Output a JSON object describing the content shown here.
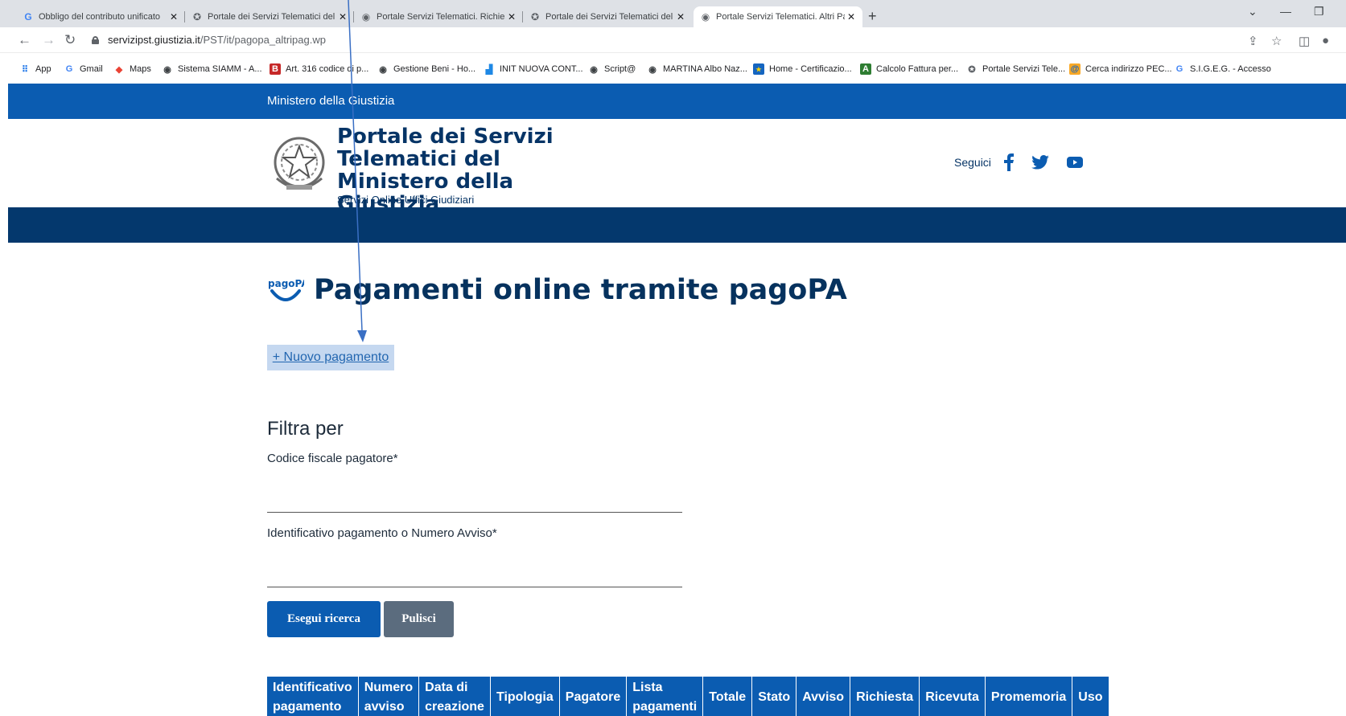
{
  "browser": {
    "tabs": [
      {
        "title": "Obbligo del contributo unificato",
        "icon": "google-icon",
        "active": false
      },
      {
        "title": "Portale dei Servizi Telematici del",
        "icon": "emblem-icon",
        "active": false
      },
      {
        "title": "Portale Servizi Telematici. Richies",
        "icon": "globe-icon",
        "active": false
      },
      {
        "title": "Portale dei Servizi Telematici del",
        "icon": "emblem-icon",
        "active": false
      },
      {
        "title": "Portale Servizi Telematici. Altri Pa",
        "icon": "globe-icon",
        "active": true
      }
    ],
    "url": {
      "domain": "servizipst.giustizia.it",
      "path": "/PST/it/pagopa_altripag.wp"
    },
    "bookmarks": [
      {
        "label": "App",
        "icon": "apps-grid-icon"
      },
      {
        "label": "Gmail",
        "icon": "google-icon"
      },
      {
        "label": "Maps",
        "icon": "maps-pin-icon"
      },
      {
        "label": "Sistema SIAMM - A...",
        "icon": "globe-icon"
      },
      {
        "label": "Art. 316 codice di p...",
        "icon": "brocardi-icon"
      },
      {
        "label": "Gestione Beni - Ho...",
        "icon": "globe-icon"
      },
      {
        "label": "INIT NUOVA CONT...",
        "icon": "chart-icon"
      },
      {
        "label": "Script@",
        "icon": "globe-icon"
      },
      {
        "label": "MARTINA Albo Naz...",
        "icon": "globe-icon"
      },
      {
        "label": "Home - Certificazio...",
        "icon": "eu-icon"
      },
      {
        "label": "Calcolo Fattura per...",
        "icon": "calc-icon"
      },
      {
        "label": "Portale Servizi Tele...",
        "icon": "emblem-icon"
      },
      {
        "label": "Cerca indirizzo PEC...",
        "icon": "pec-icon"
      },
      {
        "label": "S.I.G.E.G. - Accesso",
        "icon": "google-icon"
      }
    ]
  },
  "site": {
    "ministry": "Ministero della Giustizia",
    "title": "Portale dei Servizi Telematici del Ministero della Giustizia",
    "subtitle": "Servizi Online Uffici Giudiziari",
    "follow": "Seguici",
    "social": [
      "facebook-icon",
      "twitter-icon",
      "youtube-icon"
    ]
  },
  "page": {
    "logo_text": "pagoPA",
    "title": "Pagamenti online tramite pagoPA",
    "new_payment": "+ Nuovo pagamento",
    "filter_title": "Filtra per",
    "fields": [
      {
        "label": "Codice fiscale pagatore*",
        "value": ""
      },
      {
        "label": "Identificativo pagamento o Numero Avviso*",
        "value": ""
      }
    ],
    "search_button": "Esegui ricerca",
    "clear_button": "Pulisci",
    "table_headers": [
      [
        "Identificativo",
        "pagamento"
      ],
      [
        "Numero",
        "avviso"
      ],
      [
        "Data di",
        "creazione"
      ],
      [
        "Tipologia"
      ],
      [
        "Pagatore"
      ],
      [
        "Lista",
        "pagamenti"
      ],
      [
        "Totale"
      ],
      [
        "Stato"
      ],
      [
        "Avviso"
      ],
      [
        "Richiesta"
      ],
      [
        "Ricevuta"
      ],
      [
        "Promemoria"
      ],
      [
        "Uso"
      ]
    ]
  },
  "colors": {
    "primary": "#0b5cb1",
    "dark": "#04386d",
    "title": "#06325e",
    "secondary_button": "#5b6c7e",
    "new_payment_bg": "#c5d8f0"
  }
}
